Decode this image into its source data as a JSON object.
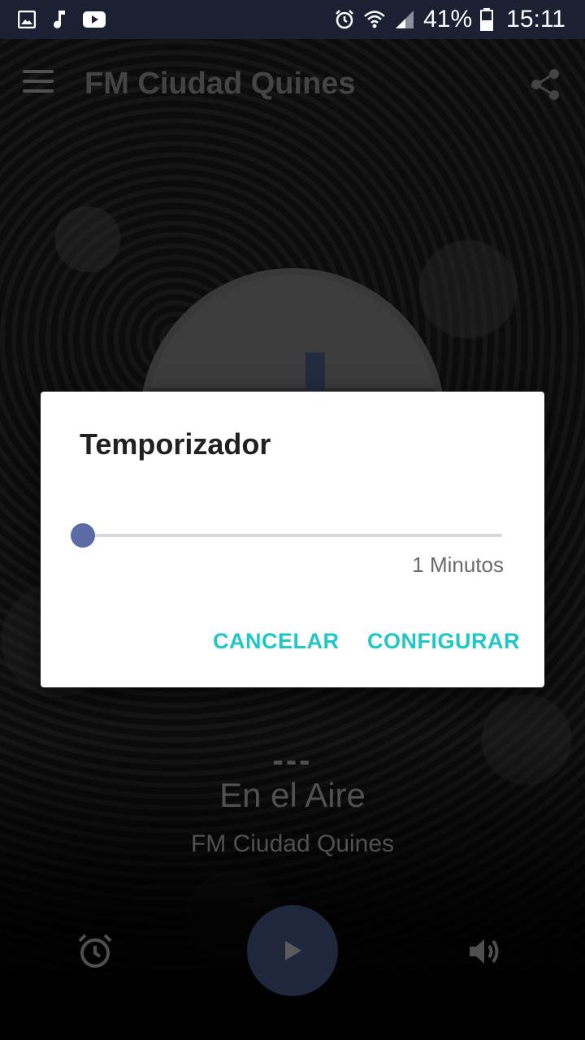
{
  "status_bar": {
    "icons_left": [
      "image-icon",
      "music-note-icon",
      "youtube-icon"
    ],
    "icons_right": [
      "alarm-icon",
      "wifi-icon",
      "signal-icon"
    ],
    "battery_text": "41%",
    "time": "15:11"
  },
  "toolbar": {
    "title": "FM Ciudad Quines"
  },
  "now_playing": {
    "dashes": "---",
    "status": "En el Aire",
    "station": "FM Ciudad Quines"
  },
  "dialog": {
    "title": "Temporizador",
    "slider_value": 0,
    "slider_label": "1 Minutos",
    "cancel_label": "CANCELAR",
    "confirm_label": "CONFIGURAR"
  },
  "colors": {
    "accent": "#21c6c6",
    "slider_thumb": "#5a6ba6",
    "status_bar": "#1b2033",
    "play_button": "#2a3551"
  }
}
